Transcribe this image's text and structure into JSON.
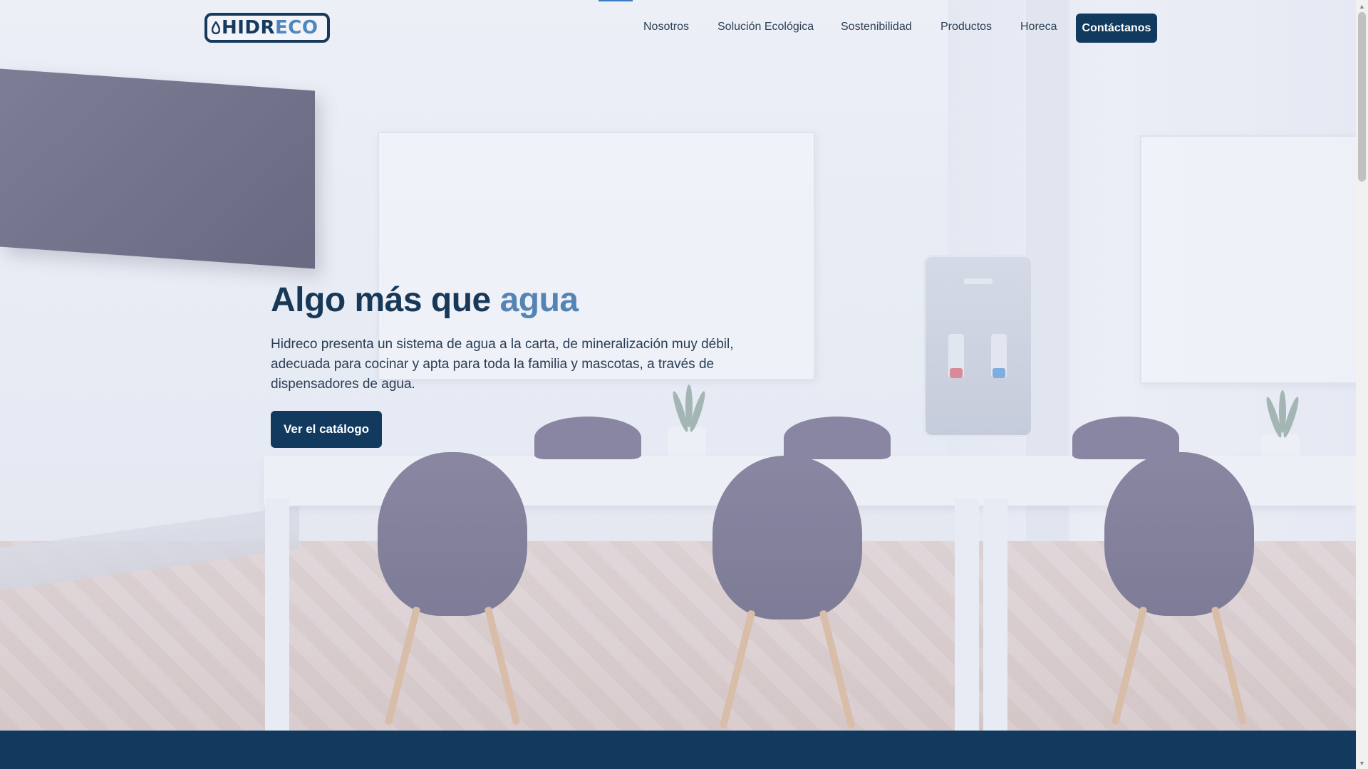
{
  "brand": {
    "logo_part1": "HIDR",
    "logo_part2": "ECO"
  },
  "nav": {
    "items": [
      {
        "label": "Nosotros"
      },
      {
        "label": "Solución Ecológica"
      },
      {
        "label": "Sostenibilidad"
      },
      {
        "label": "Productos"
      },
      {
        "label": "Horeca"
      }
    ],
    "cta_label": "Contáctanos"
  },
  "hero": {
    "title_main": "Algo más que",
    "title_accent": "agua",
    "description": "Hidreco presenta un sistema de agua a la carta, de mineralización muy débil, adecuada para cocinar y apta para toda la familia y mascotas, a través de dispensadores de agua.",
    "button_label": "Ver el catálogo"
  },
  "colors": {
    "primary": "#123a5f",
    "accent": "#5583b4",
    "text": "#2a3c52"
  },
  "icons": {
    "logo": "water-drop-icon",
    "scroll_up": "arrow-up-icon",
    "scroll_down": "arrow-down-icon"
  }
}
